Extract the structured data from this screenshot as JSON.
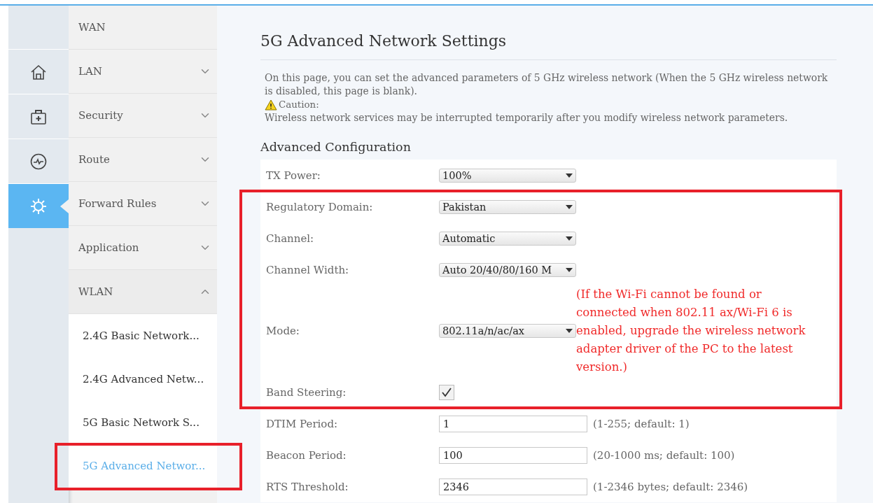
{
  "rail": [
    {
      "selected": false
    },
    {
      "selected": false
    },
    {
      "selected": false
    },
    {
      "selected": true
    }
  ],
  "menu": [
    {
      "label": "WAN"
    },
    {
      "label": "LAN",
      "expanded": false
    },
    {
      "label": "Security",
      "expanded": false
    },
    {
      "label": "Route",
      "expanded": false
    },
    {
      "label": "Forward Rules",
      "expanded": false
    },
    {
      "label": "Application",
      "expanded": false
    },
    {
      "label": "WLAN",
      "expanded": true,
      "children": [
        {
          "label": "2.4G Basic Network...",
          "selected": false,
          "highlighted": false
        },
        {
          "label": "2.4G Advanced Netw...",
          "selected": false,
          "highlighted": false
        },
        {
          "label": "5G Basic Network S...",
          "selected": false,
          "highlighted": false
        },
        {
          "label": "5G Advanced Networ...",
          "selected": true,
          "highlighted": true
        }
      ]
    }
  ],
  "page": {
    "title": "5G Advanced Network Settings",
    "intro": "On this page, you can set the advanced parameters of 5 GHz wireless network (When the 5 GHz wireless network is disabled, this page is blank).",
    "caution_label": "Caution:",
    "caution_text": "Wireless network services may be interrupted temporarily after you modify wireless network parameters.",
    "section_title": "Advanced Configuration"
  },
  "groups": [
    {
      "highlighted": false,
      "rows": [
        {
          "label": "TX Power:",
          "kind": "select",
          "value": "100%"
        }
      ]
    },
    {
      "highlighted": true,
      "rows": [
        {
          "label": "Regulatory Domain:",
          "kind": "select",
          "value": "Pakistan"
        },
        {
          "label": "Channel:",
          "kind": "select",
          "value": "Automatic"
        },
        {
          "label": "Channel Width:",
          "kind": "select",
          "value": "Auto 20/40/80/160 M"
        },
        {
          "label": "Mode:",
          "kind": "select",
          "value": "802.11a/n/ac/ax",
          "note": "(If the Wi-Fi cannot be found or connected when 802.11 ax/Wi-Fi 6 is enabled, upgrade the wireless network adapter driver of the PC to the latest version.)"
        },
        {
          "label": "Band Steering:",
          "kind": "checkbox",
          "checked": true
        }
      ]
    },
    {
      "highlighted": false,
      "rows": [
        {
          "label": "DTIM Period:",
          "kind": "input",
          "value": "1",
          "hint": "(1-255; default: 1)"
        },
        {
          "label": "Beacon Period:",
          "kind": "input",
          "value": "100",
          "hint": "(20-1000 ms; default: 100)"
        },
        {
          "label": "RTS Threshold:",
          "kind": "input",
          "value": "2346",
          "hint": "(1-2346 bytes; default: 2346)"
        }
      ]
    }
  ]
}
